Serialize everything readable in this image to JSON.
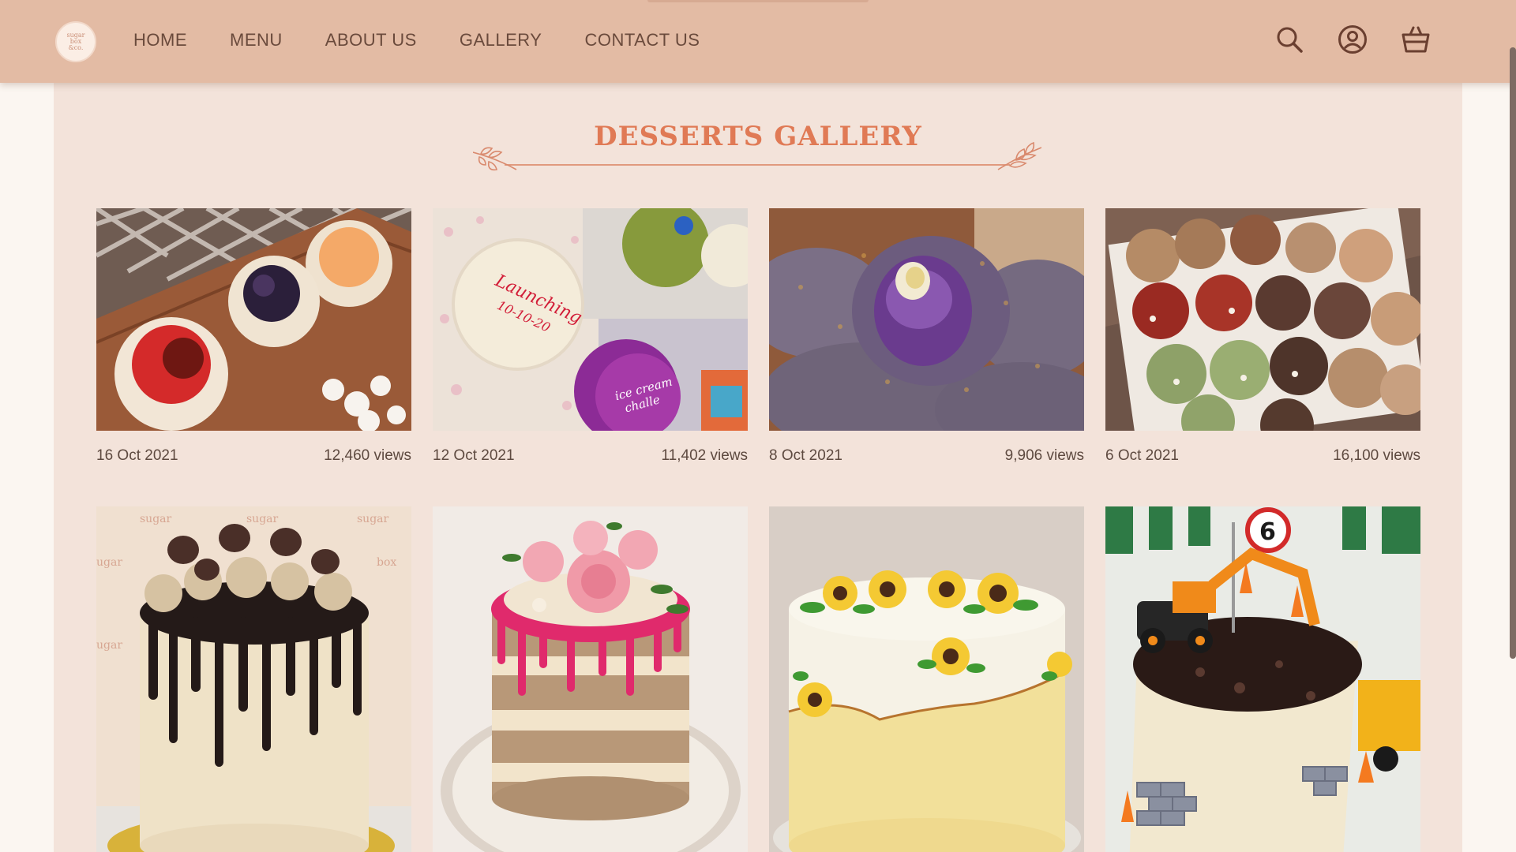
{
  "header": {
    "logo_text": [
      "sugar",
      "box",
      "&co."
    ],
    "nav": [
      {
        "id": "home",
        "label": "HOME"
      },
      {
        "id": "menu",
        "label": "MENU"
      },
      {
        "id": "about-us",
        "label": "ABOUT US"
      },
      {
        "id": "gallery",
        "label": "GALLERY"
      },
      {
        "id": "contact-us",
        "label": "CONTACT US"
      }
    ],
    "icons": [
      "search-icon",
      "user-account-icon",
      "shopping-basket-icon"
    ]
  },
  "gallery": {
    "title": "DESSERTS GALLERY",
    "items": [
      {
        "subject": "cheesecakes",
        "date": "16 Oct 2021",
        "views": "12,460 views"
      },
      {
        "subject": "bento-cakes",
        "date": "12 Oct 2021",
        "views": "11,402 views"
      },
      {
        "subject": "ube-pandesal",
        "date": "8 Oct 2021",
        "views": "9,906 views"
      },
      {
        "subject": "cookies",
        "date": "6 Oct 2021",
        "views": "16,100 views"
      },
      {
        "subject": "chocolate-drip-cake"
      },
      {
        "subject": "rose-naked-cake"
      },
      {
        "subject": "sunflower-cake"
      },
      {
        "subject": "construction-cake"
      }
    ]
  },
  "colors": {
    "header_bg": "#e3bba4",
    "panel_bg": "#f3e3da",
    "page_bg": "#fbf6f1",
    "title_accent": "#e07a55",
    "text": "#5e4a40"
  }
}
